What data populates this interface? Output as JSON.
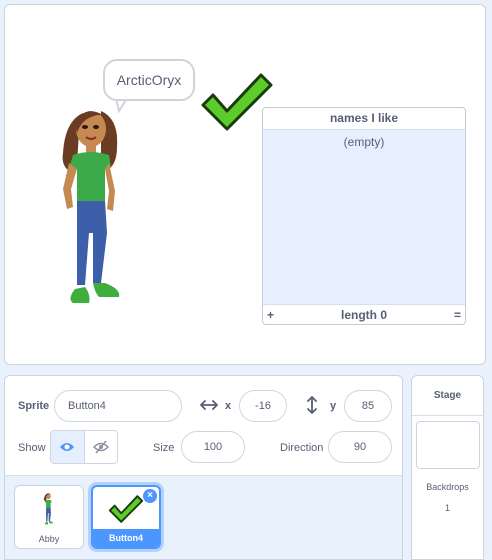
{
  "stage": {
    "speech_bubble": "ArcticOryx",
    "list_monitor": {
      "title": "names I like",
      "empty_text": "(empty)",
      "add_symbol": "+",
      "length_label": "length 0",
      "resize_symbol": "="
    }
  },
  "sprite_info": {
    "sprite_label": "Sprite",
    "sprite_name": "Button4",
    "x_label": "x",
    "x_value": "-16",
    "y_label": "y",
    "y_value": "85",
    "show_label": "Show",
    "size_label": "Size",
    "size_value": "100",
    "direction_label": "Direction",
    "direction_value": "90",
    "x_arrow_icon": "horizontal-arrows-icon",
    "y_arrow_icon": "vertical-arrows-icon",
    "show_icon": "eye-icon",
    "hide_icon": "eye-slash-icon"
  },
  "sprites": [
    {
      "name": "Abby",
      "selected": false,
      "icon": "abby-thumbnail"
    },
    {
      "name": "Button4",
      "selected": true,
      "icon": "checkmark-thumbnail"
    }
  ],
  "delete_symbol": "×",
  "stage_panel": {
    "title": "Stage",
    "backdrops_label": "Backdrops",
    "backdrops_count": "1"
  },
  "colors": {
    "accent": "#4c97ff",
    "check_green": "#5ccc2a",
    "panel_bg": "#e9f1fc"
  }
}
